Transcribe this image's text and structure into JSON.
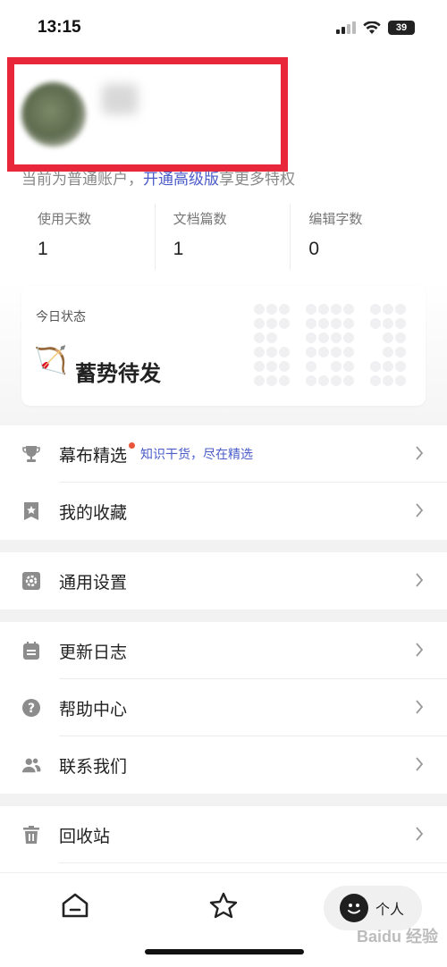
{
  "status_bar": {
    "time": "13:15",
    "battery": "39"
  },
  "profile": {
    "account_text": "当前为普通账户，",
    "upgrade_link": "开通高级版",
    "account_suffix": "享更多特权"
  },
  "stats": [
    {
      "label": "使用天数",
      "value": "1"
    },
    {
      "label": "文档篇数",
      "value": "1"
    },
    {
      "label": "编辑字数",
      "value": "0"
    }
  ],
  "today": {
    "label": "今日状态",
    "emoji": "🏹",
    "status": "蓄势待发"
  },
  "menu": {
    "featured": {
      "label": "幕布精选",
      "sub": "知识干货，尽在精选"
    },
    "favorites": {
      "label": "我的收藏"
    },
    "settings": {
      "label": "通用设置"
    },
    "changelog": {
      "label": "更新日志"
    },
    "help": {
      "label": "帮助中心"
    },
    "contact": {
      "label": "联系我们"
    },
    "trash": {
      "label": "回收站"
    }
  },
  "tabbar": {
    "me_label": "个人"
  },
  "watermark": "Baidu 经验"
}
